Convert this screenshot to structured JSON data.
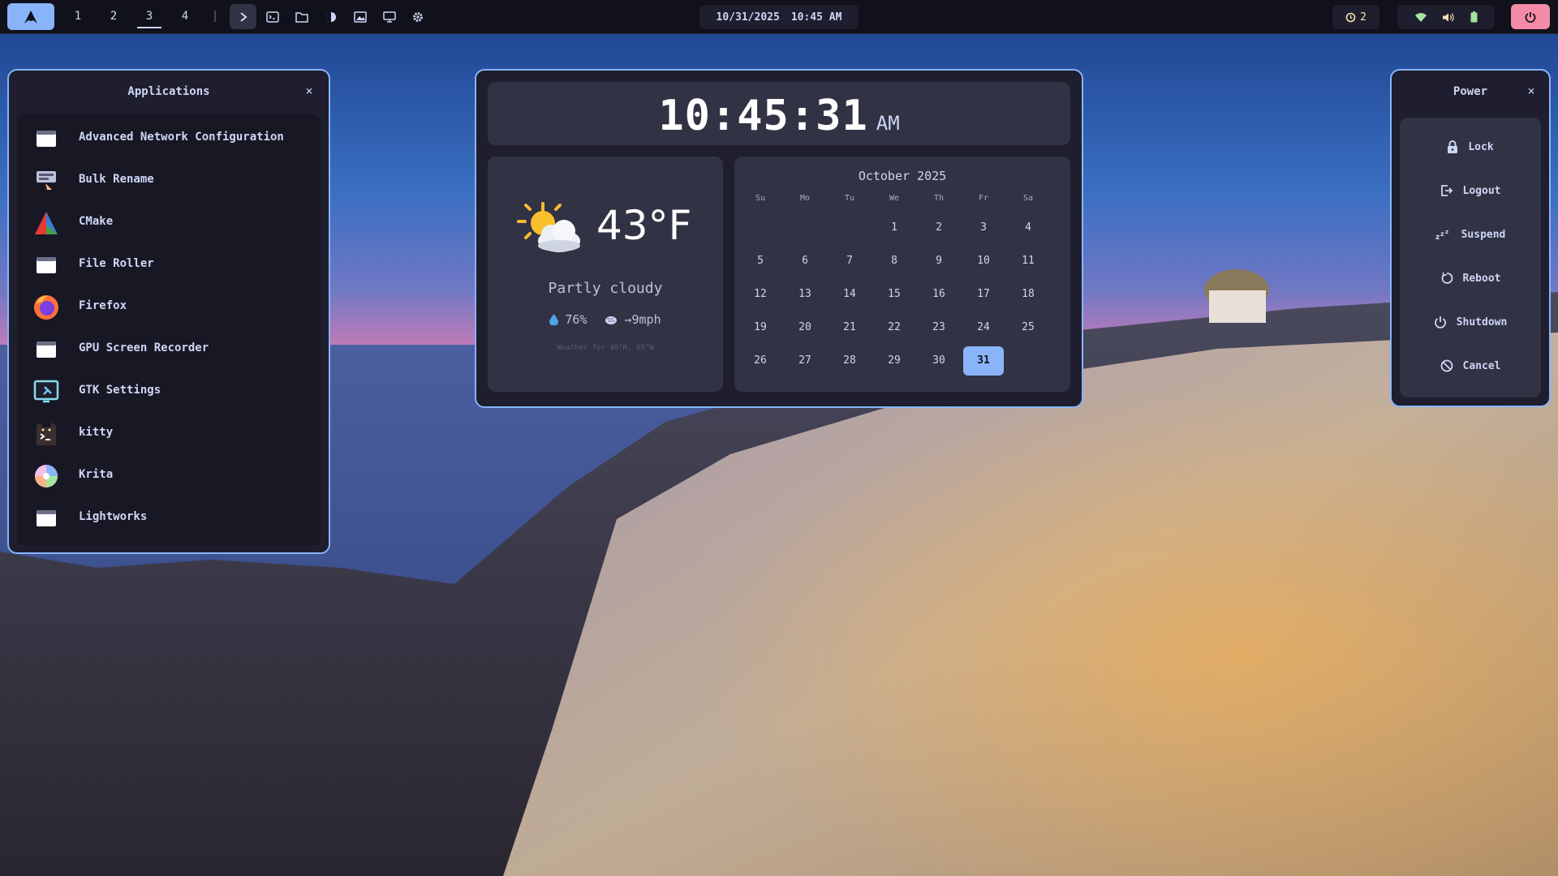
{
  "topbar": {
    "workspaces": [
      "1",
      "2",
      "3",
      "4"
    ],
    "active_workspace": "3",
    "date": "10/31/2025",
    "time": "10:45 AM",
    "notification_count": "2"
  },
  "applications": {
    "title": "Applications",
    "close_label": "×",
    "items": [
      {
        "label": "Advanced Network Configuration",
        "icon": "window-icon"
      },
      {
        "label": "Bulk Rename",
        "icon": "bulk-rename-icon"
      },
      {
        "label": "CMake",
        "icon": "cmake-icon"
      },
      {
        "label": "File Roller",
        "icon": "window-icon"
      },
      {
        "label": "Firefox",
        "icon": "firefox-icon"
      },
      {
        "label": "GPU Screen Recorder",
        "icon": "window-icon"
      },
      {
        "label": "GTK Settings",
        "icon": "gtk-settings-icon"
      },
      {
        "label": "kitty",
        "icon": "kitty-icon"
      },
      {
        "label": "Krita",
        "icon": "krita-icon"
      },
      {
        "label": "Lightworks",
        "icon": "window-icon"
      }
    ]
  },
  "clock": {
    "time": "10:45:31",
    "ampm": "AM"
  },
  "weather": {
    "temperature": "43°F",
    "condition": "Partly cloudy",
    "humidity": "76%",
    "wind": "→9mph",
    "note": "Weather for 40°N, 89°W"
  },
  "calendar": {
    "month": "October 2025",
    "weekdays": [
      "Su",
      "Mo",
      "Tu",
      "We",
      "Th",
      "Fr",
      "Sa"
    ],
    "start_weekday_index": 3,
    "days_in_month": 31,
    "today": 31
  },
  "power": {
    "title": "Power",
    "close_label": "×",
    "items": [
      {
        "label": "Lock",
        "icon": "lock-icon"
      },
      {
        "label": "Logout",
        "icon": "logout-icon"
      },
      {
        "label": "Suspend",
        "icon": "suspend-icon"
      },
      {
        "label": "Reboot",
        "icon": "reboot-icon"
      },
      {
        "label": "Shutdown",
        "icon": "shutdown-icon"
      },
      {
        "label": "Cancel",
        "icon": "cancel-icon"
      }
    ]
  },
  "colors": {
    "accent": "#89b4fa",
    "bar_bg": "#11111b",
    "panel_bg": "#1e1e2e",
    "card_bg": "#313244",
    "power_red": "#f38ba8"
  }
}
